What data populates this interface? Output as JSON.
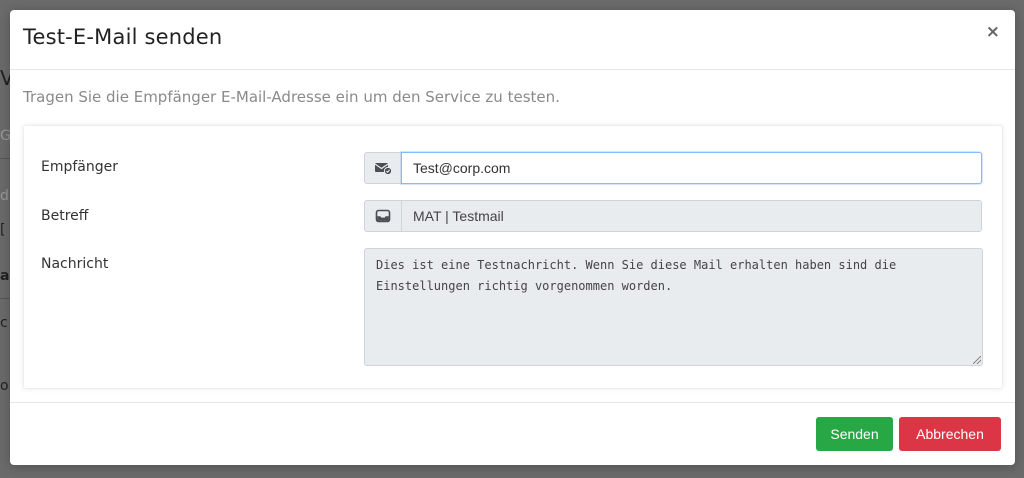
{
  "backdrop": {
    "fragments": [
      "V",
      "G",
      "d",
      "[",
      "a",
      "c",
      "o"
    ]
  },
  "modal": {
    "title": "Test-E-Mail senden",
    "close_label": "×",
    "intro": "Tragen Sie die Empfänger E-Mail-Adresse ein um den Service zu testen."
  },
  "form": {
    "recipient": {
      "label": "Empfänger",
      "value": "Test@corp.com",
      "icon": "envelope-check-icon"
    },
    "subject": {
      "label": "Betreff",
      "value": "MAT | Testmail",
      "icon": "inbox-icon"
    },
    "message": {
      "label": "Nachricht",
      "value": "Dies ist eine Testnachricht. Wenn Sie diese Mail erhalten haben sind die Einstellungen richtig vorgenommen worden."
    }
  },
  "footer": {
    "send_label": "Senden",
    "cancel_label": "Abbrechen"
  },
  "colors": {
    "send": "#28a745",
    "cancel": "#dc3545",
    "focus_border": "#80bdff"
  }
}
